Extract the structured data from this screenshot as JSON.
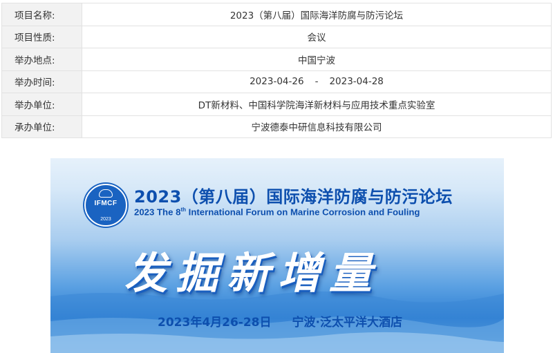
{
  "info_table": {
    "rows": [
      {
        "label": "项目名称:",
        "value": "2023（第八届）国际海洋防腐与防污论坛"
      },
      {
        "label": "项目性质:",
        "value": "会议"
      },
      {
        "label": "举办地点:",
        "value": "中国宁波"
      },
      {
        "label": "举办时间:",
        "start_date": "2023-04-26",
        "separator": "-",
        "end_date": "2023-04-28"
      },
      {
        "label": "举办单位:",
        "value": "DT新材料、中国科学院海洋新材料与应用技术重点实验室"
      },
      {
        "label": "承办单位:",
        "value": "宁波德泰中研信息科技有限公司"
      }
    ]
  },
  "banner": {
    "logo": {
      "text": "IFMCF",
      "year": "2023",
      "icon": "globe-icon"
    },
    "title_cn": "2023（第八届）国际海洋防腐与防污论坛",
    "title_en_prefix": "2023 The 8",
    "title_en_sup": "th",
    "title_en_suffix": " International Forum on Marine Corrosion and Fouling",
    "slogan": "发掘新增量",
    "date_text": "2023年4月26-28日",
    "venue_text": "宁波·泛太平洋大酒店",
    "colors": {
      "title": "#0d4fae",
      "slogan": "#ffffff",
      "sky_top": "#e6f1fb",
      "sea": "#2e7fd3"
    }
  }
}
